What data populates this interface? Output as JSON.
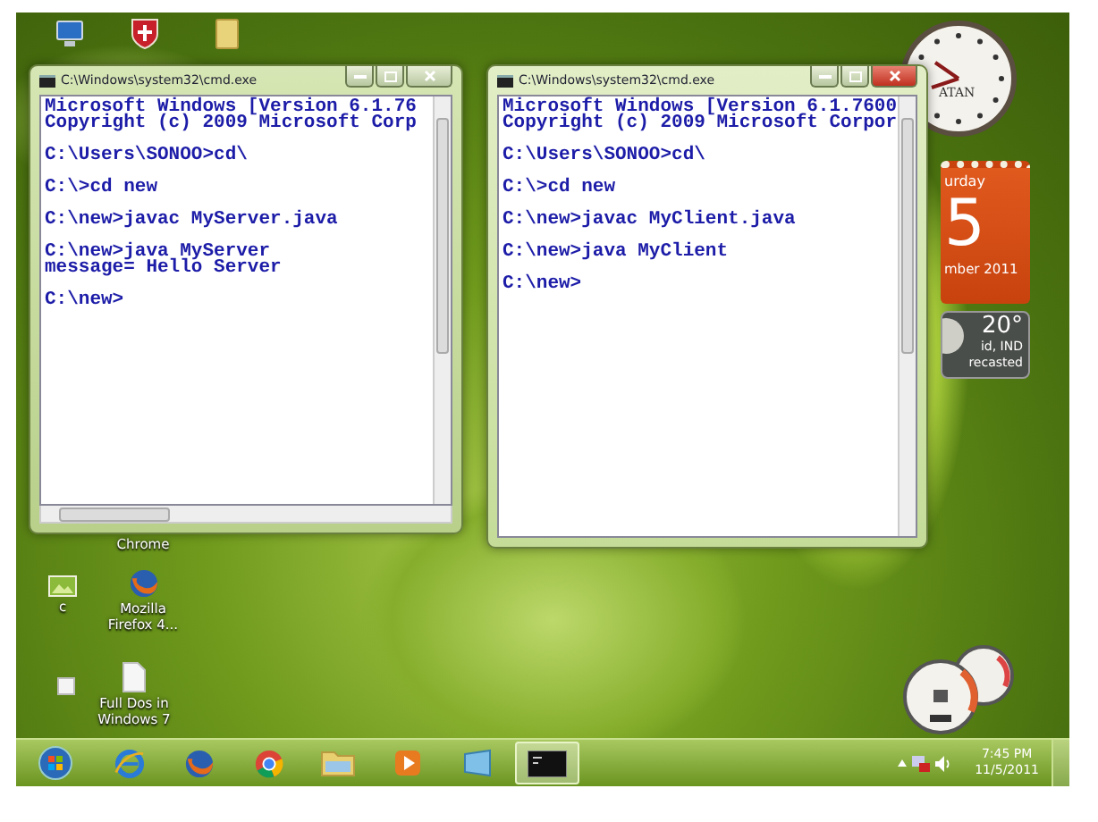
{
  "desktop_icons": [
    {
      "kind": "computer"
    },
    {
      "kind": "shield"
    },
    {
      "kind": "folder"
    },
    {
      "kind": "hidden",
      "label": "Chrome"
    },
    {
      "kind": "image",
      "label": "c"
    },
    {
      "kind": "firefox",
      "label": "Mozilla Firefox 4..."
    },
    {
      "kind": "smallfile"
    },
    {
      "kind": "file",
      "label": "Full Dos in Windows 7"
    }
  ],
  "windows": [
    {
      "title": "C:\\Windows\\system32\\cmd.exe",
      "active": false,
      "horizontal_scrollbar": true,
      "blocks": [
        [
          "Microsoft Windows [Version 6.1.76",
          "Copyright (c) 2009 Microsoft Corp"
        ],
        [
          "C:\\Users\\SONOO>cd\\"
        ],
        [
          "C:\\>cd new"
        ],
        [
          "C:\\new>javac MyServer.java"
        ],
        [
          "C:\\new>java MyServer",
          "message= Hello Server"
        ],
        [
          "C:\\new>"
        ]
      ]
    },
    {
      "title": "C:\\Windows\\system32\\cmd.exe",
      "active": true,
      "horizontal_scrollbar": false,
      "blocks": [
        [
          "Microsoft Windows [Version 6.1.7600",
          "Copyright (c) 2009 Microsoft Corpor"
        ],
        [
          "C:\\Users\\SONOO>cd\\"
        ],
        [
          "C:\\>cd new"
        ],
        [
          "C:\\new>javac MyClient.java"
        ],
        [
          "C:\\new>java MyClient"
        ],
        [
          "C:\\new>"
        ]
      ]
    }
  ],
  "gadgets": {
    "clock": {
      "label": "ATAN"
    },
    "calendar": {
      "weekday": "urday",
      "day": "5",
      "month": "mber 2011"
    },
    "weather": {
      "temperature": "20°",
      "location": "id, IND",
      "status": "recasted"
    }
  },
  "taskbar": {
    "items": [
      {
        "kind": "start",
        "selected": false
      },
      {
        "kind": "ie",
        "selected": false
      },
      {
        "kind": "firefox",
        "selected": false
      },
      {
        "kind": "chrome",
        "selected": false
      },
      {
        "kind": "folder",
        "selected": false
      },
      {
        "kind": "media",
        "selected": false
      },
      {
        "kind": "app",
        "selected": false
      },
      {
        "kind": "cmd",
        "selected": true
      }
    ],
    "time": "7:45 PM",
    "date": "11/5/2011"
  }
}
